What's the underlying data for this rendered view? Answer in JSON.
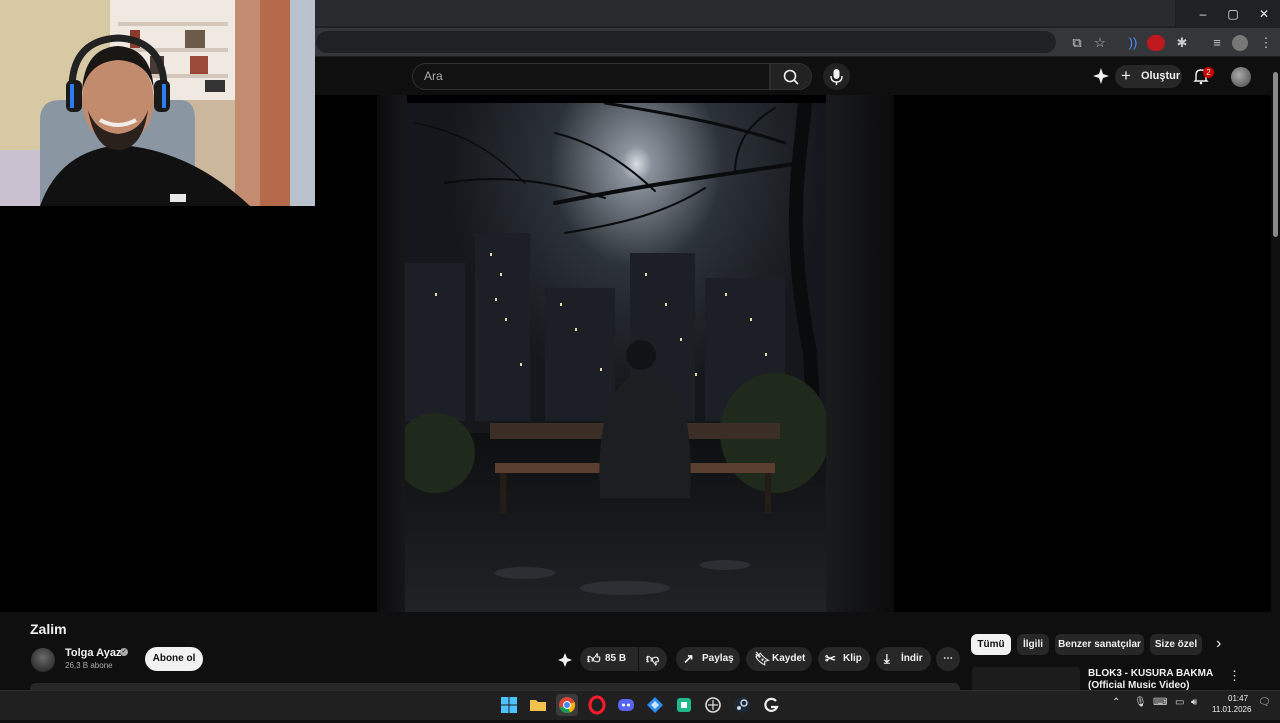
{
  "browser": {
    "window_controls": {
      "minimize": "–",
      "maximize": "▢",
      "close": "✕"
    }
  },
  "header": {
    "search_placeholder": "Ara",
    "create_label": "Oluştur",
    "notification_count": "2"
  },
  "video": {
    "title": "Zalim",
    "channel": {
      "name": "Tolga Ayaz",
      "subscribers": "26,3 B abone",
      "subscribe_label": "Abone ol"
    },
    "actions": {
      "like_count": "85 B",
      "share_label": "Paylaş",
      "save_label": "Kaydet",
      "clip_label": "Klip",
      "download_label": "İndir"
    }
  },
  "recommendations": {
    "chips": [
      "Tümü",
      "İlgili",
      "Benzer sanatçılar",
      "Size özel"
    ],
    "active_chip": "Tümü",
    "first_item_title": "BLOK3 - KUSURA BAKMA (Official Music Video)"
  },
  "taskbar": {
    "time": "01:47",
    "date": "11.01.2026"
  },
  "colors": {
    "background": "#0f0f0f",
    "pill": "#272727",
    "notification_badge": "#cc0000",
    "subscribe_bg": "#f1f1f1"
  }
}
